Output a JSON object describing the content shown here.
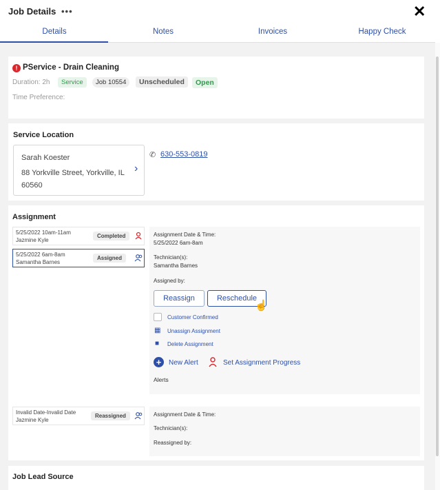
{
  "header": {
    "title": "Job Details",
    "more_icon": "more-dots-icon",
    "close_icon": "close-icon"
  },
  "tabs": [
    {
      "label": "Details",
      "active": true
    },
    {
      "label": "Notes",
      "active": false
    },
    {
      "label": "Invoices",
      "active": false
    },
    {
      "label": "Happy Check",
      "active": false
    }
  ],
  "job": {
    "title": "PService - Drain Cleaning",
    "duration": "Duration: 2h",
    "type_badge": "Service",
    "job_number": "Job 10554",
    "status_badge": "Unscheduled",
    "open_badge": "Open",
    "time_preference": "Time Preference:"
  },
  "service_location": {
    "title": "Service Location",
    "customer_name": "Sarah Koester",
    "address_line1": "88 Yorkville Street, Yorkville, IL",
    "address_line2": "60560",
    "phone": "630-553-0819"
  },
  "assignment": {
    "title": "Assignment",
    "items": [
      {
        "line1": "5/25/2022 10am-11am",
        "line2": "Jazmine Kyle",
        "badge": "Completed"
      },
      {
        "line1": "5/25/2022 6am-8am",
        "line2": "Samantha Barnes",
        "badge": "Assigned"
      },
      {
        "line1": "Invalid Date-Invalid Date",
        "line2": "Jazmine Kyle",
        "badge": "Reassigned"
      }
    ],
    "detail": {
      "date_label": "Assignment Date & Time:",
      "date_value": "5/25/2022 6am-8am",
      "tech_label": "Technician(s):",
      "tech_value": "Samantha Barnes",
      "assigned_by_label": "Assigned by:",
      "reassign_btn": "Reassign",
      "reschedule_btn": "Reschedule",
      "customer_confirmed": "Customer Confirmed",
      "unassign": "Unassign Assignment",
      "delete": "Delete Assignment",
      "new_alert": "New Alert",
      "set_progress": "Set Assignment Progress",
      "alerts_label": "Alerts"
    },
    "detail2": {
      "date_label": "Assignment Date & Time:",
      "tech_label": "Technician(s):",
      "reassigned_by_label": "Reassigned by:"
    }
  },
  "job_lead_source": {
    "title": "Job Lead Source"
  },
  "colors": {
    "accent": "#2d4fa8",
    "green": "#2e9b4a",
    "red": "#d9272e"
  }
}
